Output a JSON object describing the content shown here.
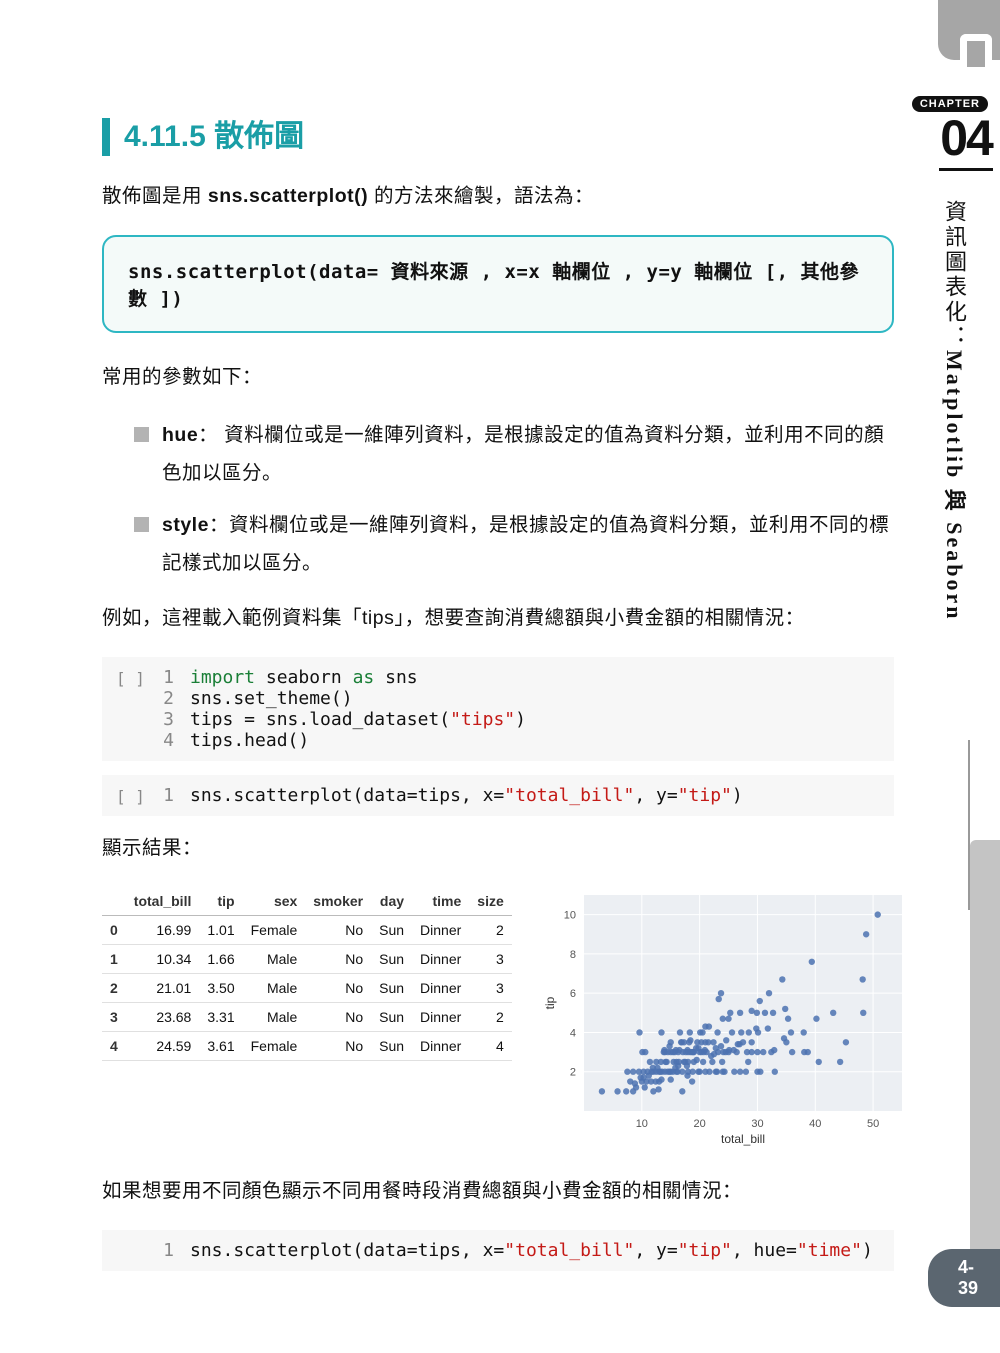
{
  "sidebar": {
    "chapter_label": "CHAPTER",
    "chapter_num": "04",
    "title_cn": "資訊圖表化：",
    "title_en": "Matplotlib 與 Seaborn",
    "page_num": "4-39"
  },
  "heading": {
    "num": "4.11.5",
    "title": " 散佈圖"
  },
  "intro": {
    "pre": "散佈圖是用 ",
    "method": "sns.scatterplot()",
    "post": " 的方法來繪製，語法為："
  },
  "syntax": "sns.scatterplot(data= 資料來源 , x=x 軸欄位 , y=y 軸欄位 [, 其他參數 ])",
  "params_intro": "常用的參數如下：",
  "params": [
    {
      "name": "hue",
      "desc": "： 資料欄位或是一維陣列資料，是根據設定的值為資料分類，並利用不同的顏色加以區分。"
    },
    {
      "name": "style",
      "desc": "：資料欄位或是一維陣列資料，是根據設定的值為資料分類，並利用不同的標記樣式加以區分。"
    }
  ],
  "example_intro": "例如，這裡載入範例資料集「tips」，想要查詢消費總額與小費金額的相關情況：",
  "code1": [
    {
      "n": "1",
      "tokens": [
        [
          "kw",
          "import"
        ],
        [
          "",
          " seaborn "
        ],
        [
          "kw",
          "as"
        ],
        [
          "",
          " sns"
        ]
      ]
    },
    {
      "n": "2",
      "tokens": [
        [
          "",
          "sns.set_theme()"
        ]
      ]
    },
    {
      "n": "3",
      "tokens": [
        [
          "",
          "tips = sns.load_dataset("
        ],
        [
          "str",
          "\"tips\""
        ],
        [
          "",
          ")"
        ]
      ]
    },
    {
      "n": "4",
      "tokens": [
        [
          "",
          "tips.head()"
        ]
      ]
    }
  ],
  "code2": [
    {
      "n": "1",
      "tokens": [
        [
          "",
          "sns.scatterplot(data=tips, x="
        ],
        [
          "str",
          "\"total_bill\""
        ],
        [
          "",
          ", y="
        ],
        [
          "str",
          "\"tip\""
        ],
        [
          "",
          ")"
        ]
      ]
    }
  ],
  "result_label": "顯示結果：",
  "table": {
    "headers": [
      "",
      "total_bill",
      "tip",
      "sex",
      "smoker",
      "day",
      "time",
      "size"
    ],
    "rows": [
      [
        "0",
        "16.99",
        "1.01",
        "Female",
        "No",
        "Sun",
        "Dinner",
        "2"
      ],
      [
        "1",
        "10.34",
        "1.66",
        "Male",
        "No",
        "Sun",
        "Dinner",
        "3"
      ],
      [
        "2",
        "21.01",
        "3.50",
        "Male",
        "No",
        "Sun",
        "Dinner",
        "3"
      ],
      [
        "3",
        "23.68",
        "3.31",
        "Male",
        "No",
        "Sun",
        "Dinner",
        "2"
      ],
      [
        "4",
        "24.59",
        "3.61",
        "Female",
        "No",
        "Sun",
        "Dinner",
        "4"
      ]
    ]
  },
  "chart_data": {
    "type": "scatter",
    "title": "",
    "xlabel": "total_bill",
    "ylabel": "tip",
    "xlim": [
      0,
      55
    ],
    "ylim": [
      0,
      11
    ],
    "xticks": [
      10,
      20,
      30,
      40,
      50
    ],
    "yticks": [
      2,
      4,
      6,
      8,
      10
    ],
    "points": [
      [
        3.1,
        1.0
      ],
      [
        5.8,
        1.0
      ],
      [
        7.3,
        1.0
      ],
      [
        7.5,
        2.0
      ],
      [
        8.0,
        1.5
      ],
      [
        8.5,
        1.0
      ],
      [
        8.5,
        2.0
      ],
      [
        8.8,
        1.4
      ],
      [
        9.0,
        1.2
      ],
      [
        9.5,
        2.0
      ],
      [
        9.6,
        4.0
      ],
      [
        9.8,
        1.7
      ],
      [
        10.0,
        1.5
      ],
      [
        10.1,
        3.0
      ],
      [
        10.3,
        1.7
      ],
      [
        10.3,
        2.0
      ],
      [
        10.5,
        1.2
      ],
      [
        10.6,
        3.0
      ],
      [
        10.8,
        1.5
      ],
      [
        11.0,
        2.0
      ],
      [
        11.2,
        1.8
      ],
      [
        11.4,
        2.5
      ],
      [
        11.6,
        1.5
      ],
      [
        11.7,
        2.0
      ],
      [
        11.9,
        2.2
      ],
      [
        12.0,
        1.0
      ],
      [
        12.0,
        2.0
      ],
      [
        12.4,
        1.5
      ],
      [
        12.5,
        2.5
      ],
      [
        12.5,
        2.0
      ],
      [
        12.7,
        2.2
      ],
      [
        12.9,
        1.1
      ],
      [
        13.0,
        1.5
      ],
      [
        13.0,
        2.0
      ],
      [
        13.2,
        2.0
      ],
      [
        13.3,
        2.5
      ],
      [
        13.4,
        1.6
      ],
      [
        13.4,
        4.0
      ],
      [
        13.5,
        2.0
      ],
      [
        13.8,
        3.0
      ],
      [
        13.9,
        3.1
      ],
      [
        14.0,
        2.0
      ],
      [
        14.0,
        3.0
      ],
      [
        14.1,
        2.5
      ],
      [
        14.3,
        2.5
      ],
      [
        14.5,
        2.0
      ],
      [
        14.5,
        3.0
      ],
      [
        14.8,
        2.0
      ],
      [
        14.8,
        3.3
      ],
      [
        15.0,
        1.6
      ],
      [
        15.0,
        2.0
      ],
      [
        15.0,
        3.0
      ],
      [
        15.0,
        3.5
      ],
      [
        15.4,
        2.0
      ],
      [
        15.4,
        3.0
      ],
      [
        15.5,
        2.5
      ],
      [
        15.7,
        3.0
      ],
      [
        15.8,
        2.2
      ],
      [
        15.9,
        3.1
      ],
      [
        16.0,
        2.0
      ],
      [
        16.0,
        2.5
      ],
      [
        16.2,
        2.0
      ],
      [
        16.3,
        3.0
      ],
      [
        16.3,
        2.3
      ],
      [
        16.4,
        2.5
      ],
      [
        16.5,
        3.1
      ],
      [
        16.6,
        4.0
      ],
      [
        16.8,
        3.5
      ],
      [
        16.9,
        3.5
      ],
      [
        17.0,
        1.0
      ],
      [
        17.0,
        2.0
      ],
      [
        17.1,
        3.0
      ],
      [
        17.3,
        2.5
      ],
      [
        17.3,
        3.5
      ],
      [
        17.5,
        2.5
      ],
      [
        17.6,
        3.0
      ],
      [
        17.8,
        2.3
      ],
      [
        17.9,
        1.8
      ],
      [
        17.9,
        3.1
      ],
      [
        18.0,
        2.0
      ],
      [
        18.0,
        2.5
      ],
      [
        18.0,
        3.0
      ],
      [
        18.2,
        3.5
      ],
      [
        18.3,
        4.0
      ],
      [
        18.4,
        3.0
      ],
      [
        18.4,
        3.6
      ],
      [
        18.7,
        1.5
      ],
      [
        18.7,
        3.0
      ],
      [
        18.8,
        2.0
      ],
      [
        18.9,
        3.0
      ],
      [
        19.0,
        2.5
      ],
      [
        19.0,
        3.0
      ],
      [
        19.4,
        3.2
      ],
      [
        19.5,
        2.6
      ],
      [
        19.6,
        3.5
      ],
      [
        19.8,
        2.0
      ],
      [
        19.8,
        3.2
      ],
      [
        20.0,
        2.0
      ],
      [
        20.0,
        3.0
      ],
      [
        20.1,
        4.0
      ],
      [
        20.3,
        3.0
      ],
      [
        20.3,
        3.5
      ],
      [
        20.5,
        4.0
      ],
      [
        20.6,
        2.5
      ],
      [
        20.7,
        3.0
      ],
      [
        20.9,
        3.1
      ],
      [
        21.0,
        2.0
      ],
      [
        21.0,
        3.5
      ],
      [
        21.0,
        4.3
      ],
      [
        21.2,
        3.0
      ],
      [
        21.5,
        3.5
      ],
      [
        21.6,
        4.3
      ],
      [
        21.7,
        2.0
      ],
      [
        22.0,
        2.8
      ],
      [
        22.2,
        2.5
      ],
      [
        22.4,
        3.5
      ],
      [
        22.5,
        2.9
      ],
      [
        22.8,
        2.0
      ],
      [
        22.8,
        3.2
      ],
      [
        23.0,
        2.0
      ],
      [
        23.1,
        4.0
      ],
      [
        23.2,
        3.0
      ],
      [
        23.3,
        5.7
      ],
      [
        23.7,
        6.0
      ],
      [
        23.7,
        3.3
      ],
      [
        23.9,
        2.5
      ],
      [
        24.0,
        4.7
      ],
      [
        24.0,
        2.0
      ],
      [
        24.1,
        3.0
      ],
      [
        24.3,
        2.0
      ],
      [
        24.5,
        3.0
      ],
      [
        24.6,
        3.6
      ],
      [
        25.0,
        3.0
      ],
      [
        25.0,
        4.7
      ],
      [
        25.1,
        3.1
      ],
      [
        25.3,
        5.0
      ],
      [
        25.6,
        4.0
      ],
      [
        25.9,
        3.1
      ],
      [
        26.0,
        2.0
      ],
      [
        26.4,
        3.0
      ],
      [
        26.6,
        3.4
      ],
      [
        26.9,
        3.4
      ],
      [
        27.0,
        2.0
      ],
      [
        27.0,
        5.0
      ],
      [
        27.2,
        4.0
      ],
      [
        27.5,
        3.5
      ],
      [
        28.0,
        2.0
      ],
      [
        28.2,
        3.0
      ],
      [
        28.4,
        2.5
      ],
      [
        28.5,
        4.0
      ],
      [
        29.0,
        3.0
      ],
      [
        29.0,
        3.5
      ],
      [
        29.0,
        5.1
      ],
      [
        29.8,
        4.2
      ],
      [
        29.9,
        5.0
      ],
      [
        30.0,
        2.0
      ],
      [
        30.0,
        3.0
      ],
      [
        30.1,
        4.0
      ],
      [
        30.4,
        5.6
      ],
      [
        30.5,
        2.0
      ],
      [
        31.0,
        3.0
      ],
      [
        31.3,
        5.0
      ],
      [
        31.8,
        4.2
      ],
      [
        32.0,
        6.0
      ],
      [
        32.4,
        3.0
      ],
      [
        32.7,
        5.0
      ],
      [
        32.9,
        3.1
      ],
      [
        33.0,
        2.0
      ],
      [
        34.3,
        6.7
      ],
      [
        34.6,
        3.7
      ],
      [
        34.8,
        5.2
      ],
      [
        35.0,
        3.5
      ],
      [
        35.3,
        4.7
      ],
      [
        35.8,
        4.0
      ],
      [
        36.0,
        3.0
      ],
      [
        38.0,
        4.0
      ],
      [
        38.1,
        3.0
      ],
      [
        38.7,
        3.0
      ],
      [
        39.4,
        7.6
      ],
      [
        40.2,
        4.7
      ],
      [
        40.6,
        2.5
      ],
      [
        43.1,
        5.0
      ],
      [
        44.3,
        2.5
      ],
      [
        45.3,
        3.5
      ],
      [
        48.2,
        6.7
      ],
      [
        48.3,
        5.0
      ],
      [
        48.8,
        9.0
      ],
      [
        50.8,
        10.0
      ]
    ]
  },
  "hue_intro": "如果想要用不同顏色顯示不同用餐時段消費總額與小費金額的相關情況：",
  "code3": [
    {
      "n": "1",
      "tokens": [
        [
          "",
          "sns.scatterplot(data=tips, x="
        ],
        [
          "str",
          "\"total_bill\""
        ],
        [
          "",
          ", y="
        ],
        [
          "str",
          "\"tip\""
        ],
        [
          "",
          ", hue="
        ],
        [
          "str",
          "\"time\""
        ],
        [
          "",
          ")"
        ]
      ]
    }
  ]
}
